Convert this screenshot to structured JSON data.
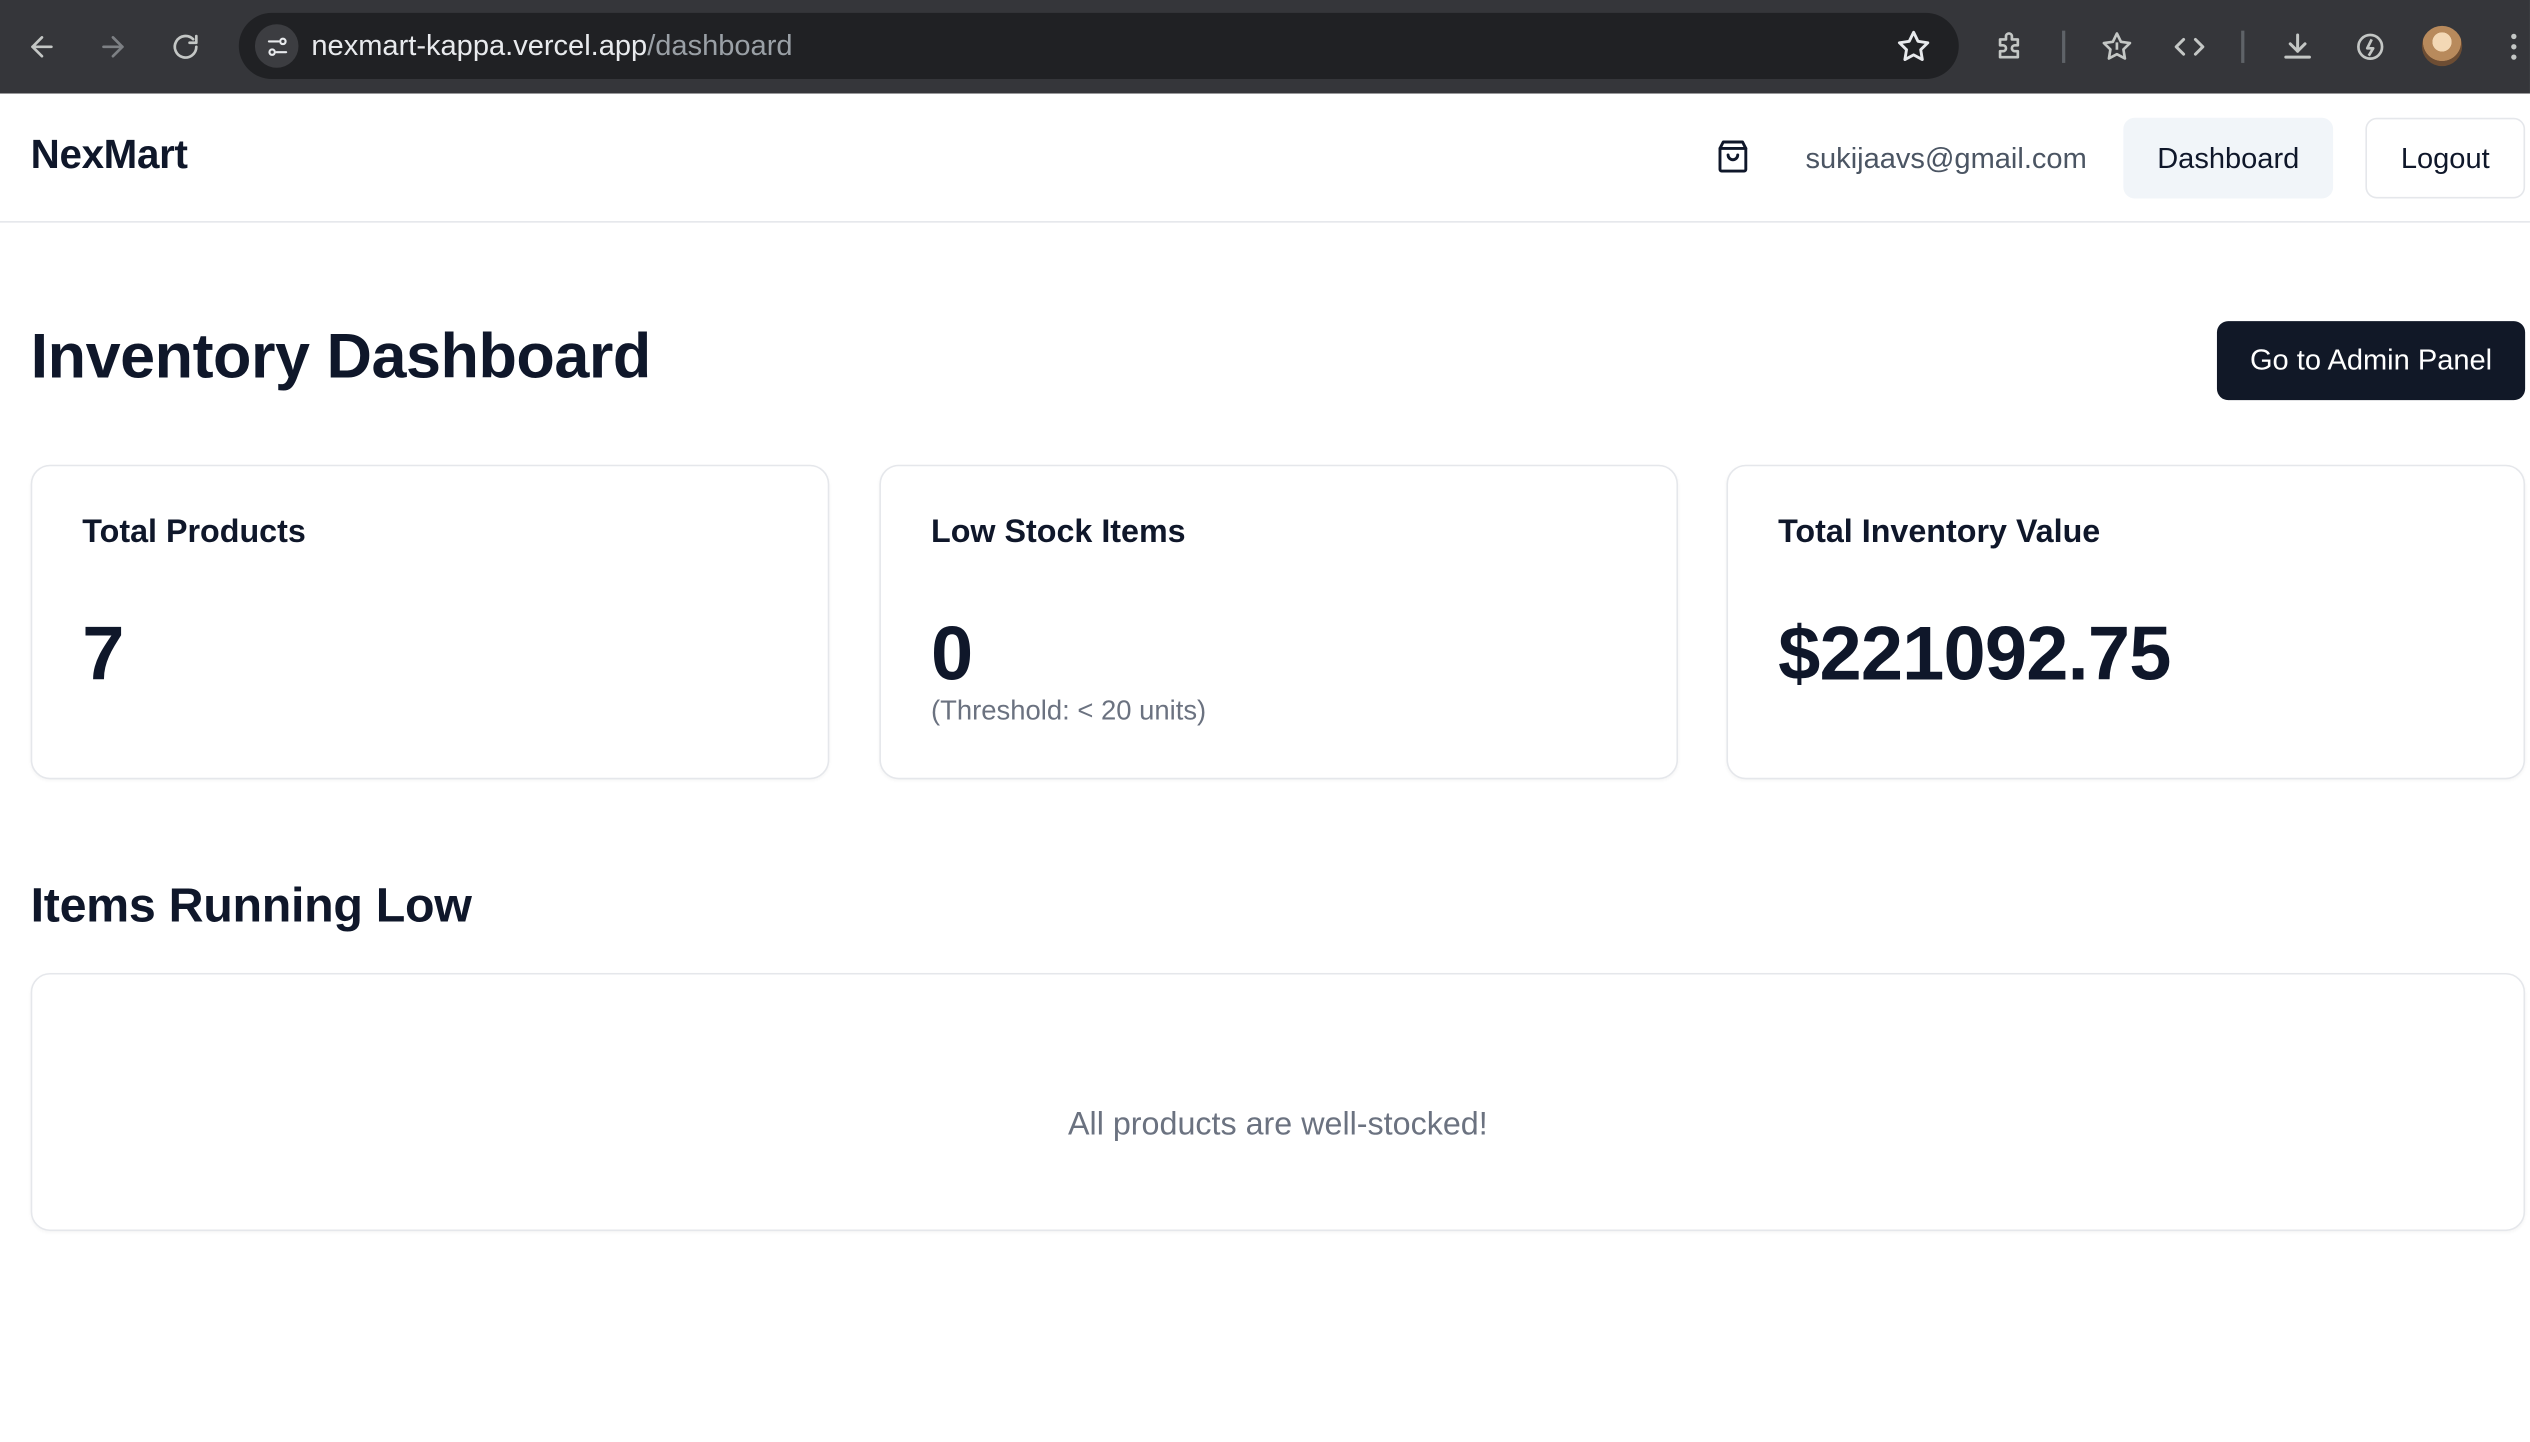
{
  "browser": {
    "url_host": "nexmart-kappa.vercel.app",
    "url_path": "/dashboard",
    "icons": [
      "back-icon",
      "forward-icon",
      "reload-icon",
      "site-info-icon",
      "bookmark-star-icon",
      "extensions-icon",
      "bookmarks-icon",
      "devtools-code-icon",
      "download-icon",
      "performance-icon",
      "profile-avatar",
      "more-menu-icon"
    ]
  },
  "header": {
    "brand": "NexMart",
    "cart_icon": "shopping-bag-icon",
    "user_email": "sukijaavs@gmail.com",
    "dashboard_label": "Dashboard",
    "logout_label": "Logout"
  },
  "main": {
    "title": "Inventory Dashboard",
    "admin_button_label": "Go to Admin Panel",
    "stats": [
      {
        "label": "Total Products",
        "value": "7",
        "note": ""
      },
      {
        "label": "Low Stock Items",
        "value": "0",
        "note": "(Threshold: < 20 units)"
      },
      {
        "label": "Total Inventory Value",
        "value": "$221092.75",
        "note": ""
      }
    ],
    "low_stock_section": {
      "title": "Items Running Low",
      "empty_message": "All products are well-stocked!"
    }
  },
  "colors": {
    "browser_bg": "#35363a",
    "omnibox_bg": "#202124",
    "primary_button": "#111827",
    "secondary_button": "#f1f5f9",
    "muted_text": "#6b7280",
    "border": "#e5e7eb"
  }
}
